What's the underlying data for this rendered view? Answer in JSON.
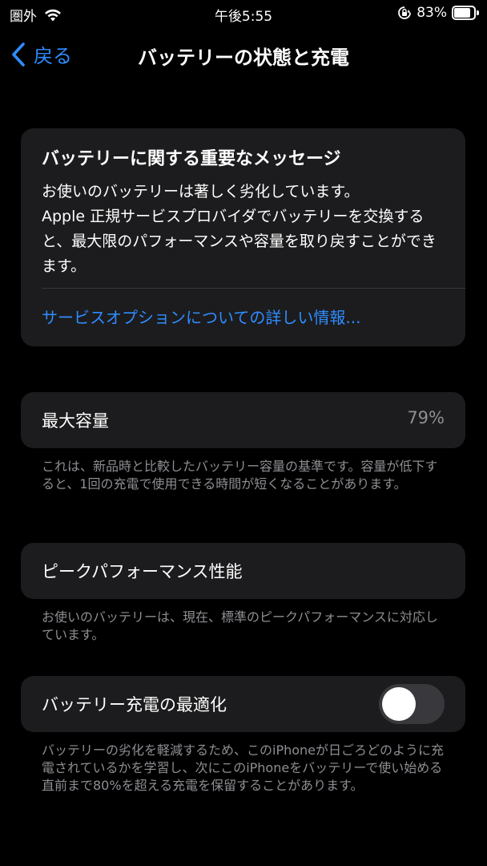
{
  "status_bar": {
    "carrier": "圏外",
    "time": "午後5:55",
    "battery_percent_text": "83%",
    "battery_level": 0.83
  },
  "nav": {
    "back_label": "戻る",
    "title": "バッテリーの状態と充電"
  },
  "message": {
    "title": "バッテリーに関する重要なメッセージ",
    "body": "お使いのバッテリーは著しく劣化しています。\nApple 正規サービスプロバイダでバッテリーを交換すると、最大限のパフォーマンスや容量を取り戻すことができます。",
    "link": "サービスオプションについての詳しい情報..."
  },
  "capacity": {
    "label": "最大容量",
    "value": "79%",
    "footnote": "これは、新品時と比較したバッテリー容量の基準です。容量が低下すると、1回の充電で使用できる時間が短くなることがあります。"
  },
  "peak": {
    "label": "ピークパフォーマンス性能",
    "footnote": "お使いのバッテリーは、現在、標準のピークパフォーマンスに対応しています。"
  },
  "optimized": {
    "label": "バッテリー充電の最適化",
    "enabled": false,
    "footnote": "バッテリーの劣化を軽減するため、このiPhoneが日ごろどのように充電されているかを学習し、次にこのiPhoneをバッテリーで使い始める直前まで80%を超える充電を保留することがあります。"
  },
  "colors": {
    "accent": "#2f8cff",
    "card": "#1c1c1e",
    "secondary_text": "#8e8e93"
  },
  "icons": {
    "status": [
      "wifi-icon",
      "orientation-lock-icon",
      "battery-icon"
    ],
    "nav": "chevron-left-icon"
  }
}
